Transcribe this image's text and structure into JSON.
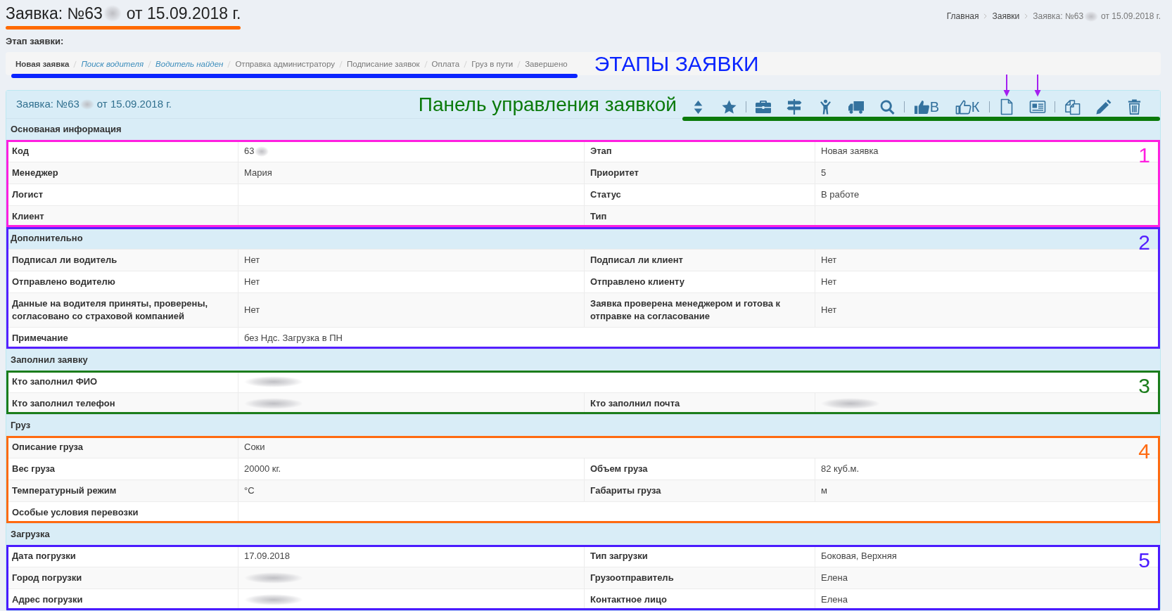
{
  "page_title": {
    "text": "Заявка: №63",
    "redacted": true,
    "after": "от 15.09.2018 г.",
    "annotation": {
      "kind": "underline",
      "color": "#ff6a00"
    }
  },
  "breadcrumb": [
    {
      "text": "Главная",
      "redacted": false,
      "active": false
    },
    {
      "text": "Заявки",
      "redacted": false,
      "active": false
    },
    {
      "text": "Заявка: №63",
      "redacted": true,
      "after": "от 15.09.2018 г.",
      "active": true
    }
  ],
  "stages": {
    "label": "Этап заявки:",
    "items": [
      {
        "text": "Новая заявка",
        "selected": true,
        "link": false
      },
      {
        "text": "Поиск водителя",
        "selected": false,
        "link": true
      },
      {
        "text": "Водитель найден",
        "selected": false,
        "link": true
      },
      {
        "text": "Отправка администратору",
        "selected": false,
        "link": false
      },
      {
        "text": "Подписание заявок",
        "selected": false,
        "link": false
      },
      {
        "text": "Оплата",
        "selected": false,
        "link": false
      },
      {
        "text": "Груз в пути",
        "selected": false,
        "link": false
      },
      {
        "text": "Завершено",
        "selected": false,
        "link": false
      }
    ],
    "annotation": {
      "kind": "underline",
      "color": "#0a24ff",
      "caption": "ЭТАПЫ ЗАЯВКИ"
    }
  },
  "panel": {
    "title": {
      "text": "Заявка: №63",
      "redacted": true,
      "after": "от 15.09.2018 г."
    },
    "toolbar": {
      "annotation": {
        "kind": "underline",
        "color": "#0b7a0b",
        "caption": "Панель управления заявкой"
      },
      "items": [
        {
          "kind": "button",
          "pointed": false
        },
        {
          "kind": "button",
          "pointed": false
        },
        {
          "kind": "separator"
        },
        {
          "kind": "button",
          "pointed": false
        },
        {
          "kind": "button",
          "pointed": false
        },
        {
          "kind": "button",
          "pointed": false
        },
        {
          "kind": "button",
          "pointed": false
        },
        {
          "kind": "button",
          "pointed": false
        },
        {
          "kind": "separator"
        },
        {
          "kind": "button",
          "letter": "В",
          "pointed": false
        },
        {
          "kind": "button",
          "letter": "К",
          "pointed": false
        },
        {
          "kind": "separator"
        },
        {
          "kind": "button",
          "pointed": true
        },
        {
          "kind": "button",
          "pointed": true
        },
        {
          "kind": "separator"
        },
        {
          "kind": "button",
          "pointed": false
        },
        {
          "kind": "button",
          "pointed": false
        },
        {
          "kind": "button",
          "pointed": false
        }
      ]
    },
    "sections": [
      {
        "title": "Основаная информация",
        "annotation": {
          "kind": "box",
          "number": "1",
          "color": "#ff1fe0",
          "covers_title": false
        },
        "rows": [
          [
            {
              "label": "Код",
              "value": "63",
              "redacted": true
            },
            {
              "label": "Этап",
              "value": "Новая заявка",
              "redacted": false
            }
          ],
          [
            {
              "label": "Менеджер",
              "value": "Мария",
              "redacted": false
            },
            {
              "label": "Приоритет",
              "value": "5",
              "redacted": false
            }
          ],
          [
            {
              "label": "Логист",
              "redacted": false
            },
            {
              "label": "Статус",
              "value": "В работе",
              "redacted": false
            }
          ],
          [
            {
              "label": "Клиент",
              "redacted": false
            },
            {
              "label": "Тип",
              "redacted": false
            }
          ]
        ]
      },
      {
        "title": "Дополнительно",
        "annotation": {
          "kind": "box",
          "number": "2",
          "color": "#5520ff",
          "covers_title": true
        },
        "rows": [
          [
            {
              "label": "Подписал ли водитель",
              "value": "Нет",
              "redacted": false
            },
            {
              "label": "Подписал ли клиент",
              "value": "Нет",
              "redacted": false
            }
          ],
          [
            {
              "label": "Отправлено водителю",
              "value": "Нет",
              "redacted": false
            },
            {
              "label": "Отправлено клиенту",
              "value": "Нет",
              "redacted": false
            }
          ],
          [
            {
              "label": "Данные на водителя приняты, проверены, согласовано со страховой компанией",
              "value": "Нет",
              "redacted": false
            },
            {
              "label": "Заявка проверена менеджером и готова к отправке на согласование",
              "value": "Нет",
              "redacted": false
            }
          ],
          [
            {
              "label": "Примечание",
              "value": "без Ндс. Загрузка в ПН",
              "redacted": false
            }
          ]
        ]
      },
      {
        "title": "Заполнил заявку",
        "annotation": {
          "kind": "box",
          "number": "3",
          "color": "#1b7d1b",
          "covers_title": false
        },
        "rows": [
          [
            {
              "label": "Кто заполнил ФИО",
              "redacted": true
            }
          ],
          [
            {
              "label": "Кто заполнил телефон",
              "redacted": true
            },
            {
              "label": "Кто заполнил почта",
              "redacted": true
            }
          ]
        ]
      },
      {
        "title": "Груз",
        "annotation": {
          "kind": "box",
          "number": "4",
          "color": "#ff6a10",
          "covers_title": false
        },
        "rows": [
          [
            {
              "label": "Описание груза",
              "value": "Соки",
              "redacted": false
            }
          ],
          [
            {
              "label": "Вес груза",
              "value": "20000 кг.",
              "redacted": false
            },
            {
              "label": "Объем груза",
              "value": "82 куб.м.",
              "redacted": false
            }
          ],
          [
            {
              "label": "Температурный режим",
              "value": "°C",
              "redacted": false
            },
            {
              "label": "Габариты груза",
              "value": "м",
              "redacted": false
            }
          ],
          [
            {
              "label": "Особые условия перевозки",
              "redacted": false
            }
          ]
        ]
      },
      {
        "title": "Загрузка",
        "annotation": {
          "kind": "box",
          "number": "5",
          "color": "#4a1aff",
          "covers_title": false
        },
        "rows": [
          [
            {
              "label": "Дата погрузки",
              "value": "17.09.2018",
              "redacted": false
            },
            {
              "label": "Тип загрузки",
              "value": "Боковая, Верхняя",
              "redacted": false
            }
          ],
          [
            {
              "label": "Город погрузки",
              "redacted": true
            },
            {
              "label": "Грузоотправитель",
              "value": "Елена",
              "redacted": false
            }
          ],
          [
            {
              "label": "Адрес погрузки",
              "redacted": true
            },
            {
              "label": "Контактное лицо",
              "value": "Елена",
              "redacted": false
            }
          ]
        ]
      }
    ]
  }
}
